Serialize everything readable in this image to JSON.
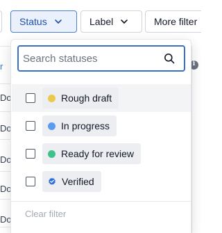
{
  "toolbar": {
    "status_label": "Status",
    "label_label": "Label",
    "more_filters_label": "More filter"
  },
  "table": {
    "header_fragment": "r",
    "row_fragments": [
      "Do",
      "Do",
      "Do",
      "Do",
      "Do"
    ]
  },
  "dropdown": {
    "search_placeholder": "Search statuses",
    "options": [
      {
        "label": "Rough draft",
        "color": "#ecc94b",
        "icon": "circle-dot-icon"
      },
      {
        "label": "In progress",
        "color": "#5b9bf0",
        "icon": "circle-dot-icon"
      },
      {
        "label": "Ready for review",
        "color": "#3fc28a",
        "icon": "circle-dot-icon"
      },
      {
        "label": "Verified",
        "color": "#2f6fdb",
        "icon": "verified-badge-icon"
      }
    ],
    "clear_label": "Clear filter"
  },
  "colors": {
    "accent": "#3b6fc7",
    "active_button_bg": "#eaf1fd"
  }
}
